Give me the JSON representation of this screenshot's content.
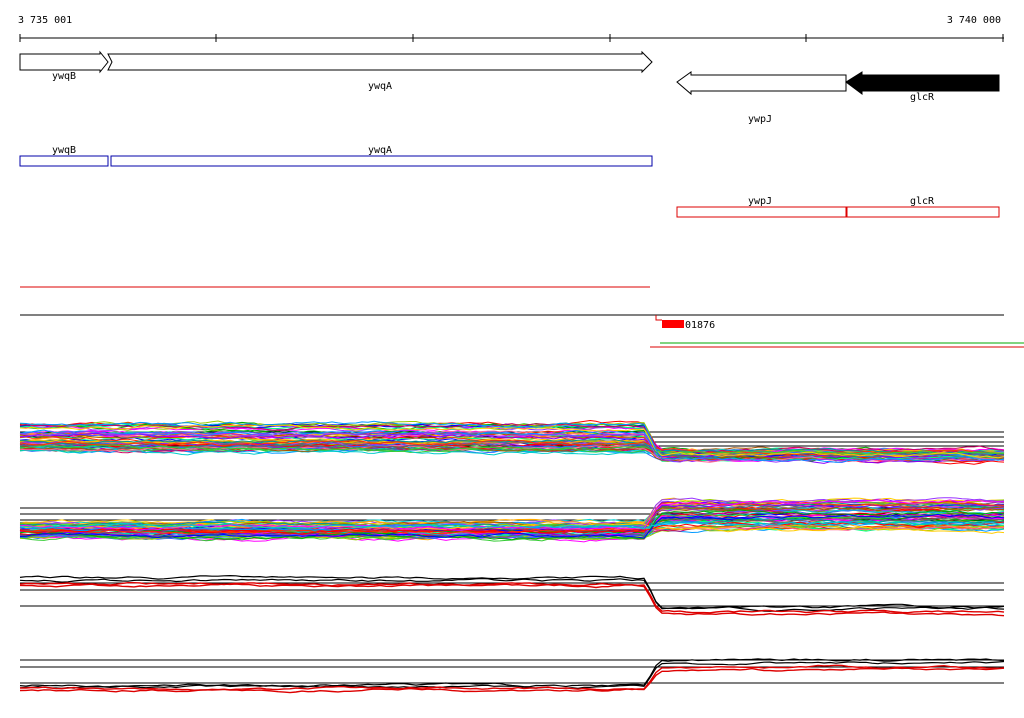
{
  "axis": {
    "start_label": "3 735 001",
    "end_label": "3 740 000"
  },
  "genes": [
    {
      "name": "ywqB",
      "strand": "+"
    },
    {
      "name": "ywqA",
      "strand": "+"
    },
    {
      "name": "ywpJ",
      "strand": "-"
    },
    {
      "name": "glcR",
      "strand": "-"
    }
  ],
  "upper_track_labels": [
    "ywqB",
    "ywqA"
  ],
  "lower_track_labels": [
    "ywpJ",
    "glcR"
  ],
  "feature_label": "01876",
  "colors": {
    "gene_outline": "#000000",
    "highlight_gene": "#000000",
    "forward_track": "#0000aa",
    "reverse_track": "#dd0000",
    "feature_mark": "#ff0000"
  }
}
